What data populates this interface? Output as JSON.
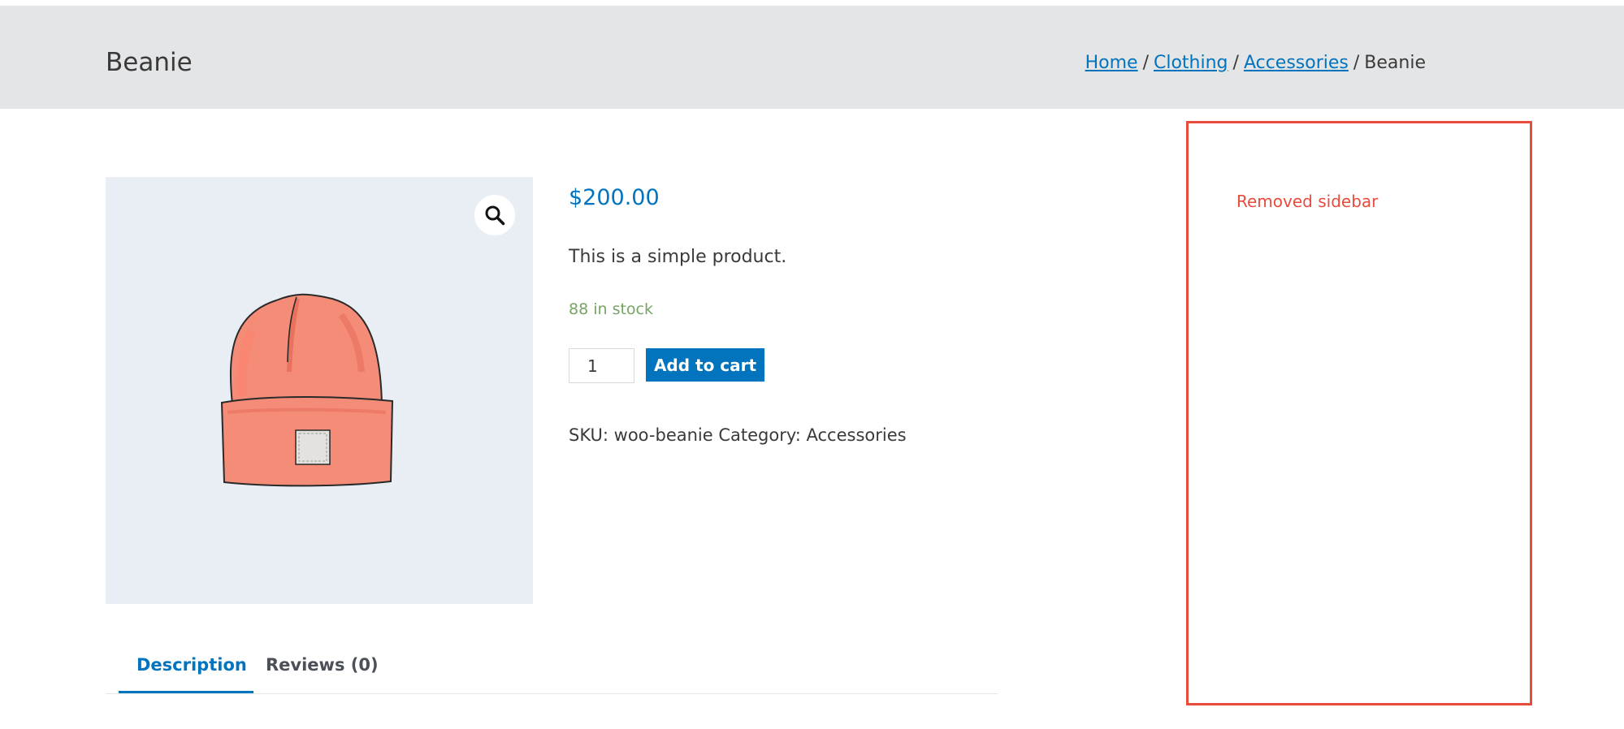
{
  "header": {
    "title": "Beanie",
    "breadcrumb": {
      "items": [
        {
          "label": "Home",
          "link": true
        },
        {
          "label": "Clothing",
          "link": true
        },
        {
          "label": "Accessories",
          "link": true
        },
        {
          "label": "Beanie",
          "link": false
        }
      ],
      "separator": "/"
    }
  },
  "product": {
    "image_icon": "beanie-hat-illustration",
    "zoom_icon": "magnifier-icon",
    "price": "$200.00",
    "short_description": "This is a simple product.",
    "stock": "88 in stock",
    "quantity": "1",
    "add_to_cart_label": "Add to cart",
    "meta": "SKU: woo-beanie Category: Accessories"
  },
  "tabs": [
    {
      "label": "Description",
      "active": true
    },
    {
      "label": "Reviews (0)",
      "active": false
    }
  ],
  "sidebar": {
    "label": "Removed sidebar"
  },
  "colors": {
    "accent": "#0274be",
    "header_bg": "#e4e5e7",
    "stock": "#77a464",
    "sidebar_border": "#e74c3c",
    "image_bg": "#e8eef3"
  }
}
